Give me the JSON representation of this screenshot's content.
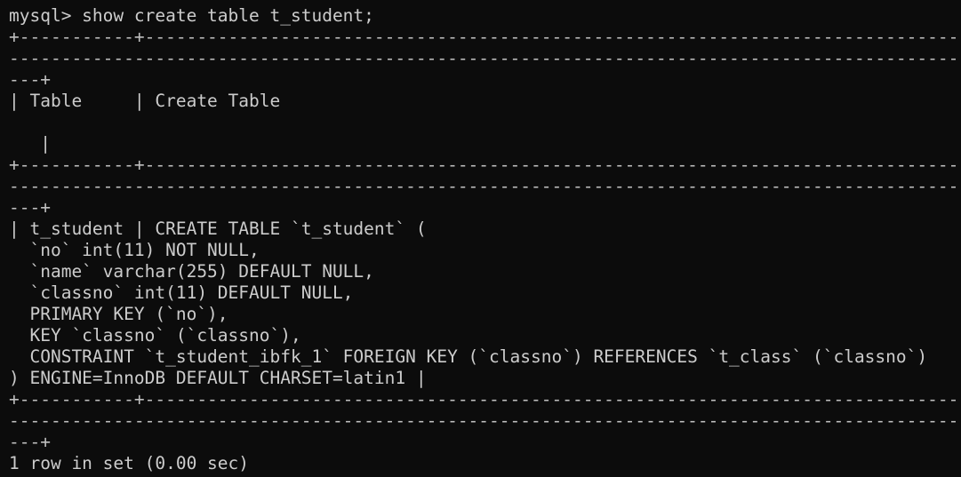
{
  "terminal": {
    "prompt_line": "mysql> show create table t_student;",
    "border_top_1": "+-----------+-----------------------------------------------------------------------------------------------------------------------------------------------------------------------------",
    "border_top_2": "--------------------------------------------------------------------------------------------------------------------------------------------------------------------------------------",
    "border_top_3": "---+",
    "header_line": "| Table     | Create Table",
    "header_pipe": "   |",
    "border_mid_1": "+-----------+-----------------------------------------------------------------------------------------------------------------------------------------------------------------------------",
    "border_mid_2": "--------------------------------------------------------------------------------------------------------------------------------------------------------------------------------------",
    "border_mid_3": "---+",
    "row_lines": [
      "| t_student | CREATE TABLE `t_student` (",
      "  `no` int(11) NOT NULL,",
      "  `name` varchar(255) DEFAULT NULL,",
      "  `classno` int(11) DEFAULT NULL,",
      "  PRIMARY KEY (`no`),",
      "  KEY `classno` (`classno`),",
      "  CONSTRAINT `t_student_ibfk_1` FOREIGN KEY (`classno`) REFERENCES `t_class` (`classno`)",
      ") ENGINE=InnoDB DEFAULT CHARSET=latin1 |"
    ],
    "border_bot_1": "+-----------+-----------------------------------------------------------------------------------------------------------------------------------------------------------------------------",
    "border_bot_2": "--------------------------------------------------------------------------------------------------------------------------------------------------------------------------------------",
    "border_bot_3": "---+",
    "result_line": "1 row in set (0.00 sec)"
  },
  "colors": {
    "background": "#0c0c0c",
    "foreground": "#cccccc"
  }
}
